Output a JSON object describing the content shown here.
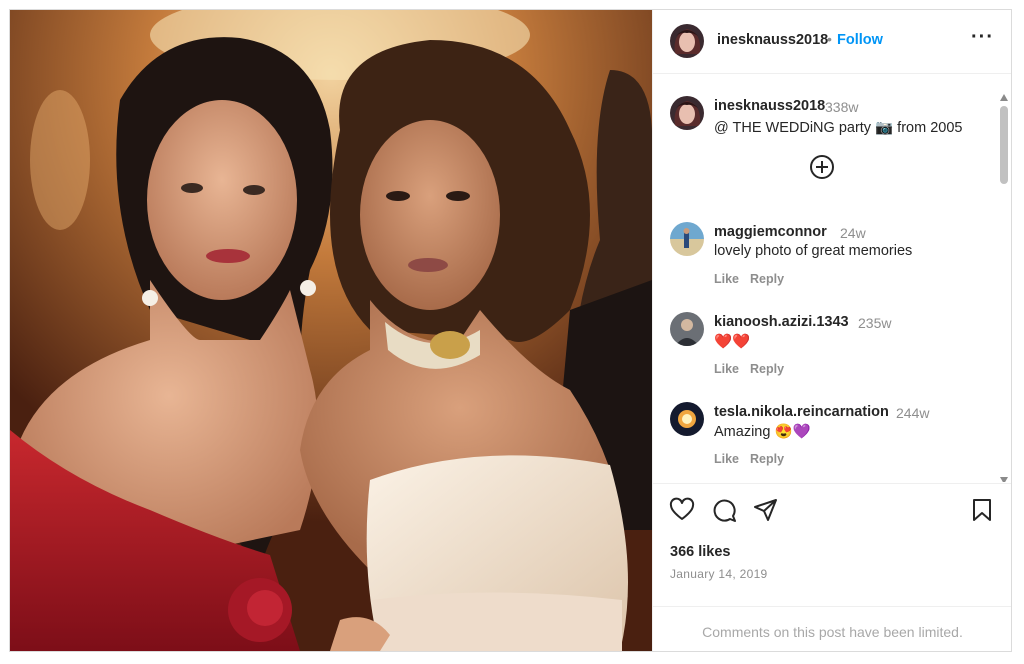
{
  "post": {
    "username": "inesknauss2018",
    "separator": "•",
    "follow_label": "Follow",
    "more_label": "···",
    "caption": {
      "username": "inesknauss2018",
      "time": "338w",
      "text": "@ THE WEDDiNG party 📷 from 2005"
    },
    "comments": [
      {
        "username": "maggiemconnor",
        "time": "24w",
        "text": "lovely photo of great memories",
        "like_label": "Like",
        "reply_label": "Reply"
      },
      {
        "username": "kianoosh.azizi.1343",
        "time": "235w",
        "text": "❤️❤️",
        "like_label": "Like",
        "reply_label": "Reply"
      },
      {
        "username": "tesla.nikola.reincarnation",
        "time": "244w",
        "text": "Amazing 😍💜",
        "like_label": "Like",
        "reply_label": "Reply"
      }
    ],
    "likes": "366 likes",
    "date": "January 14, 2019",
    "comments_limited": "Comments on this post have been limited."
  },
  "icons": {
    "more": "more-options-icon",
    "load_more": "plus-circle-icon",
    "like": "heart-icon",
    "comment": "comment-bubble-icon",
    "share": "paper-plane-icon",
    "save": "bookmark-icon"
  },
  "colors": {
    "follow": "#0095f6",
    "secondary_text": "#8e8e8e",
    "border": "#dbdbdb"
  }
}
